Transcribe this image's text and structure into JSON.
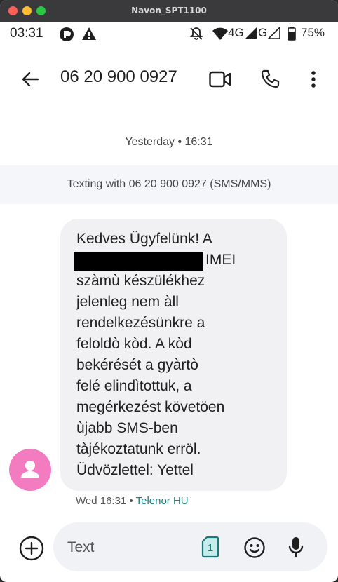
{
  "window": {
    "title": "Navon_SPT1100"
  },
  "status_bar": {
    "time": "03:31",
    "network_1": "4G",
    "network_2": "G",
    "battery": "75%"
  },
  "app_bar": {
    "contact": "06 20 900 0927"
  },
  "conversation": {
    "day_separator": "Yesterday • 16:31",
    "texting_info": "Texting with 06 20 900 0927 (SMS/MMS)",
    "message": {
      "lines": [
        "Kedves Ügyfelünk! A",
        "IMEI",
        "szàmù készülékhez",
        "jelenleg nem àll",
        "rendelkezésünkre a",
        "feloldò kòd. A kòd",
        "bekérését a gyàrtò",
        "felé elindìtottuk, a",
        "megérkezést követöen",
        "ùjabb SMS-ben",
        "tàjékoztatunk erröl.",
        "Üdvözlettel: Yettel"
      ],
      "time": "Wed 16:31",
      "separator": " • ",
      "network": "Telenor HU"
    }
  },
  "composer": {
    "placeholder": "Text",
    "sim_slot": "1"
  },
  "colors": {
    "accent": "#1a7a7a",
    "avatar": "#f37bbf",
    "bubble": "#f1f1f4"
  }
}
